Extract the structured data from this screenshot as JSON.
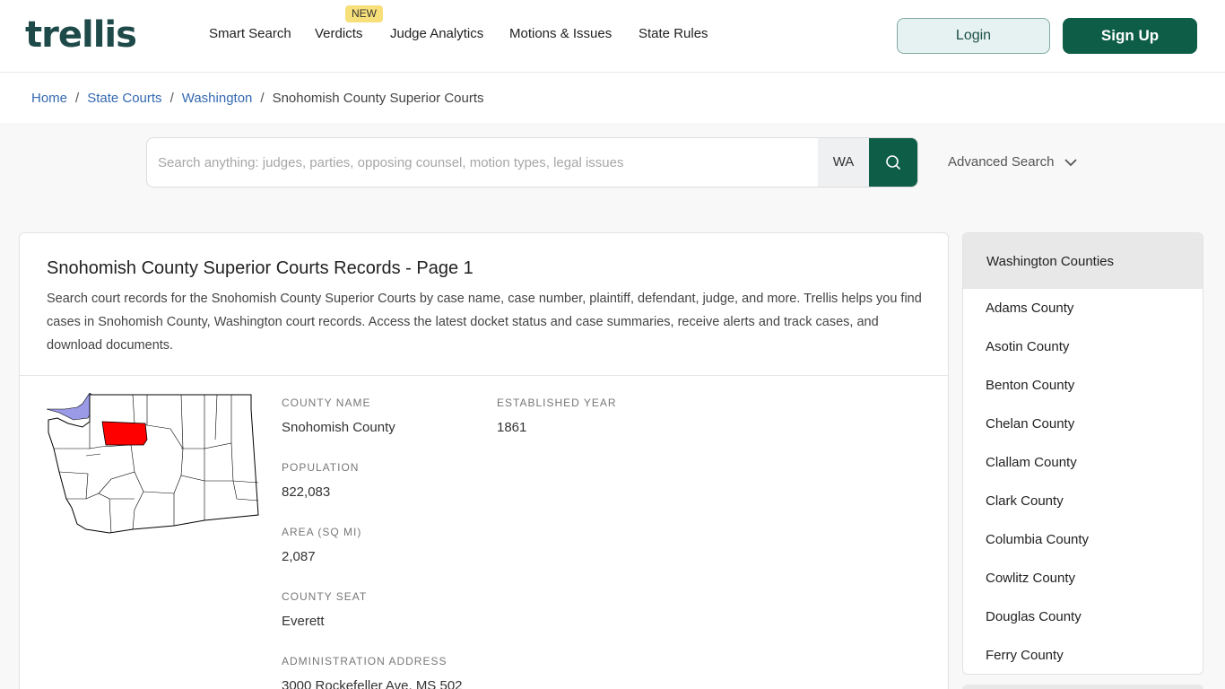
{
  "header": {
    "logo": "trellis",
    "nav": [
      "Smart Search",
      "Verdicts",
      "Judge Analytics",
      "Motions & Issues",
      "State Rules"
    ],
    "new_badge": "NEW",
    "login": "Login",
    "signup": "Sign Up"
  },
  "breadcrumb": {
    "home": "Home",
    "state_courts": "State Courts",
    "state": "Washington",
    "current": "Snohomish County Superior Courts"
  },
  "search": {
    "placeholder": "Search anything: judges, parties, opposing counsel, motion types, legal issues",
    "state": "WA",
    "advanced": "Advanced Search"
  },
  "main": {
    "title": "Snohomish County Superior Courts Records - Page 1",
    "description": "Search court records for the Snohomish County Superior Courts by case name, case number, plaintiff, defendant, judge, and more. Trellis helps you find cases in Snohomish County, Washington court records. Access the latest docket status and case summaries, receive alerts and track cases, and download documents.",
    "fields": {
      "county_name_label": "County Name",
      "county_name": "Snohomish County",
      "established_label": "Established Year",
      "established": "1861",
      "population_label": "Population",
      "population": "822,083",
      "area_label": "Area (sq mi)",
      "area": "2,087",
      "seat_label": "County Seat",
      "seat": "Everett",
      "address_label": "Administration Address",
      "address": "3000 Rockefeller Ave, MS 502"
    }
  },
  "sidebar": {
    "title": "Washington Counties",
    "counties": [
      "Adams County",
      "Asotin County",
      "Benton County",
      "Chelan County",
      "Clallam County",
      "Clark County",
      "Columbia County",
      "Cowlitz County",
      "Douglas County",
      "Ferry County"
    ]
  },
  "colors": {
    "brand": "#0e5e47",
    "highlight_county": "#ff0000",
    "water": "#9a9ae6",
    "link": "#3469b0"
  }
}
